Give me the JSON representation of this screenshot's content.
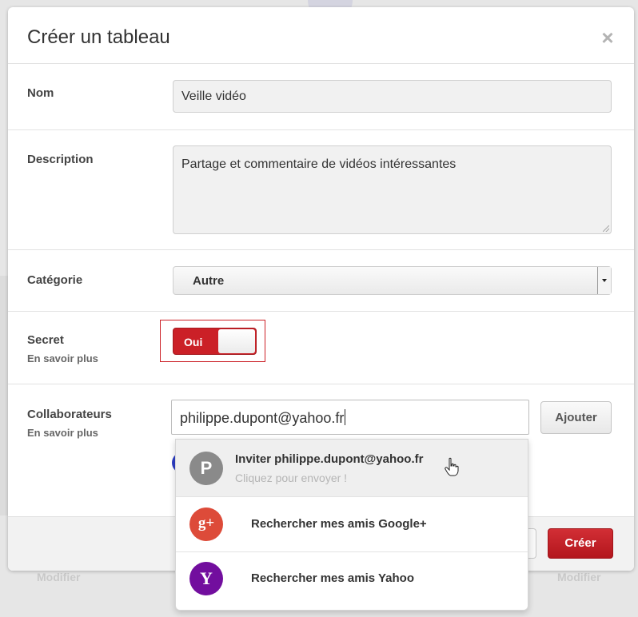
{
  "background": {
    "modifier_left": "Modifier",
    "modifier_right": "Modifier"
  },
  "dialog": {
    "title": "Créer un tableau",
    "close_icon": "close-icon"
  },
  "form": {
    "name": {
      "label": "Nom",
      "value": "Veille vidéo"
    },
    "description": {
      "label": "Description",
      "value": "Partage et commentaire de vidéos intéressantes"
    },
    "category": {
      "label": "Catégorie",
      "value": "Autre"
    },
    "secret": {
      "label": "Secret",
      "learn_more": "En savoir plus",
      "toggle_label": "Oui"
    },
    "collaborators": {
      "label": "Collaborateurs",
      "learn_more": "En savoir plus",
      "input_value": "philippe.dupont@yahoo.fr",
      "add_label": "Ajouter"
    }
  },
  "suggestions": [
    {
      "avatar_letter": "P",
      "title": "Inviter philippe.dupont@yahoo.fr",
      "subtitle": "Cliquez pour envoyer !",
      "icon": "user-avatar-icon"
    },
    {
      "avatar_letter": "g+",
      "title": "Rechercher mes amis Google+",
      "icon": "google-plus-icon"
    },
    {
      "avatar_letter": "Y",
      "title": "Rechercher mes amis Yahoo",
      "icon": "yahoo-icon"
    }
  ],
  "footer": {
    "create_label": "Créer"
  },
  "colors": {
    "accent_red": "#cb2027",
    "google_red": "#dd4b39",
    "yahoo_purple": "#720e9e",
    "avatar_gray": "#8a8a8a"
  }
}
